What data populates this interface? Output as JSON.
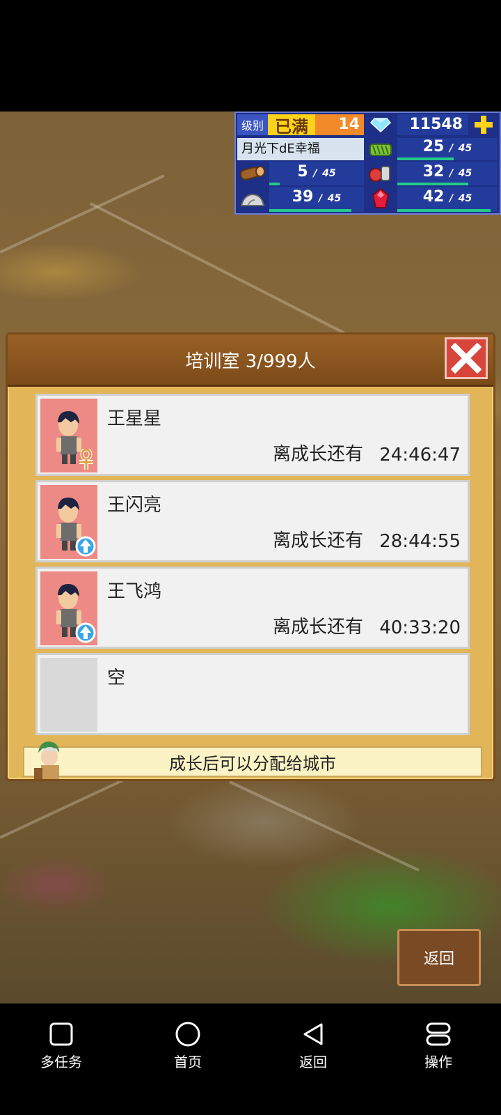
{
  "hud": {
    "level_label": "级别",
    "level_status": "已满",
    "level_value": "14",
    "gems": "11548",
    "player_name": "月光下dE幸福",
    "resources": [
      {
        "icon": "crop-icon",
        "current": "25",
        "max": "45",
        "fill": 0.56
      },
      {
        "icon": "wood-icon",
        "current": "5",
        "max": "45",
        "fill": 0.11
      },
      {
        "icon": "food-icon",
        "current": "32",
        "max": "45",
        "fill": 0.71
      },
      {
        "icon": "stone-icon",
        "current": "39",
        "max": "45",
        "fill": 0.87
      },
      {
        "icon": "ruby-icon",
        "current": "42",
        "max": "45",
        "fill": 0.93
      }
    ]
  },
  "dialog": {
    "title": "培训室 3/999人",
    "rows": [
      {
        "name": "王星星",
        "label": "离成长还有",
        "time": "24:46:47",
        "badge": "ankh-icon"
      },
      {
        "name": "王闪亮",
        "label": "离成长还有",
        "time": "28:44:55",
        "badge": "up-arrow-icon"
      },
      {
        "name": "王飞鸿",
        "label": "离成长还有",
        "time": "40:33:20",
        "badge": "up-arrow-icon"
      },
      {
        "name": "空"
      }
    ],
    "hint": "成长后可以分配给城市"
  },
  "back_button": "返回",
  "navbar": {
    "items": [
      {
        "label": "多任务",
        "icon": "square-icon"
      },
      {
        "label": "首页",
        "icon": "circle-icon"
      },
      {
        "label": "返回",
        "icon": "triangle-back-icon"
      },
      {
        "label": "操作",
        "icon": "menu-pill-icon"
      }
    ]
  }
}
